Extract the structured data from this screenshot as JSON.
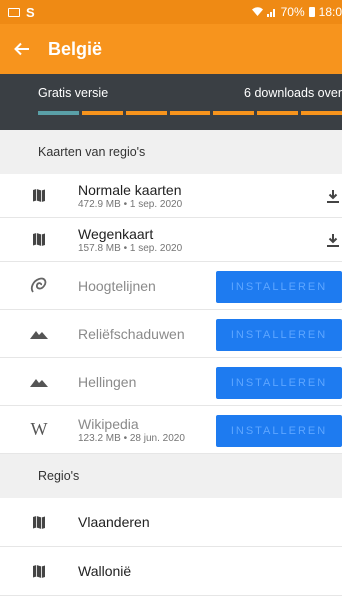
{
  "status_bar": {
    "app_letter": "S",
    "battery": "70%",
    "time": "18:0"
  },
  "toolbar": {
    "title": "België"
  },
  "version": {
    "label": "Gratis versie",
    "downloads": "6 downloads over",
    "downloads_used": 1,
    "downloads_total": 7
  },
  "maps_section": {
    "header": "Kaarten van regio's",
    "items": [
      {
        "title": "Normale kaarten",
        "subtitle": "472.9 MB • 1 sep. 2020"
      },
      {
        "title": "Wegenkaart",
        "subtitle": "157.8 MB • 1 sep. 2020"
      }
    ],
    "features": [
      {
        "title": "Hoogtelijnen",
        "button": "INSTALLEREN",
        "icon": "contour-icon"
      },
      {
        "title": "Reliëfschaduwen",
        "button": "INSTALLEREN",
        "icon": "mountain-icon"
      },
      {
        "title": "Hellingen",
        "button": "INSTALLEREN",
        "icon": "mountain-icon"
      },
      {
        "title": "Wikipedia",
        "subtitle": "123.2 MB • 28 jun. 2020",
        "button": "INSTALLEREN",
        "icon": "wikipedia-icon",
        "icon_text": "W"
      }
    ]
  },
  "regions_section": {
    "header": "Regio's",
    "items": [
      {
        "title": "Vlaanderen"
      },
      {
        "title": "Wallonië"
      }
    ]
  },
  "colors": {
    "toolbar": "#f7941d",
    "version_bar": "#3a3f44",
    "install_button": "#1e7bf0"
  }
}
